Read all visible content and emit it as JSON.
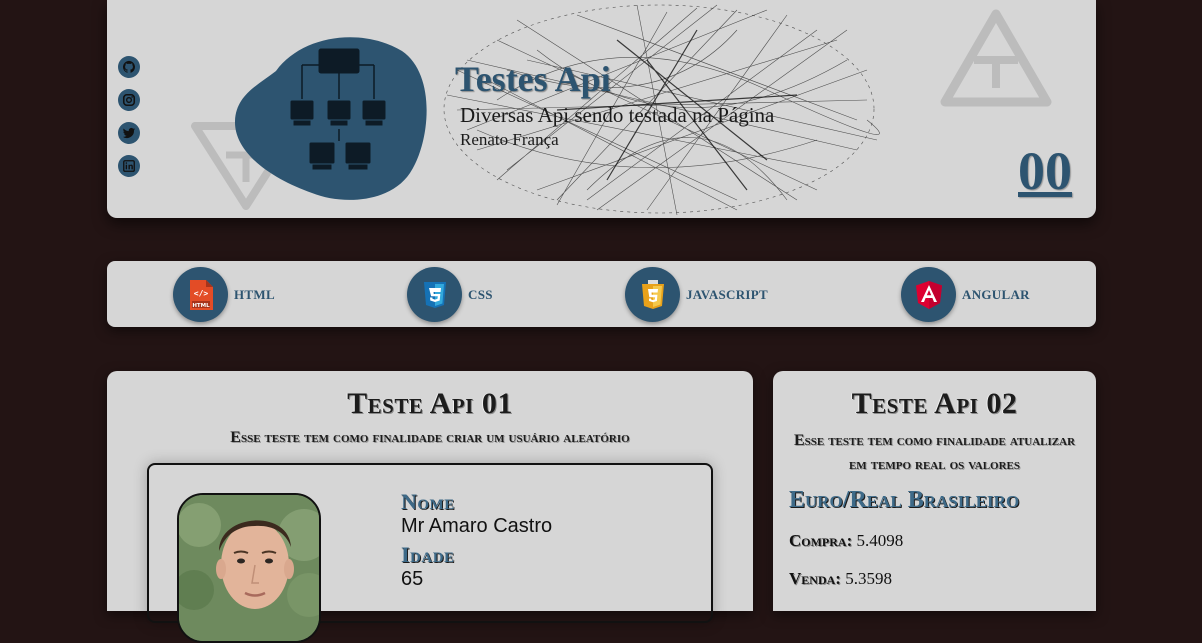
{
  "header": {
    "title": "Testes Api",
    "subtitle": "Diversas Api sendo testada na Página",
    "author": "Renato França",
    "counter": "00",
    "social": [
      "github-icon",
      "instagram-icon",
      "twitter-icon",
      "linkedin-icon"
    ]
  },
  "techs": [
    {
      "label": "HTML",
      "icon": "html5-file-icon",
      "color": "#e34c26"
    },
    {
      "label": "CSS",
      "icon": "css3-icon",
      "color": "#1572b6"
    },
    {
      "label": "JAVASCRIPT",
      "icon": "javascript-icon",
      "color": "#f0b429"
    },
    {
      "label": "ANGULAR",
      "icon": "angular-icon",
      "color": "#dd0031"
    }
  ],
  "card1": {
    "title": "Teste Api 01",
    "description": "Esse teste tem como finalidade criar um usuário aleatório",
    "name_label": "Nome",
    "name_value": "Mr Amaro Castro",
    "age_label": "Idade",
    "age_value": "65"
  },
  "card2": {
    "title": "Teste Api 02",
    "description": "Esse teste tem como finalidade atualizar em tempo real os valores",
    "pair_title": "Euro/Real Brasileiro",
    "buy_label": "Compra:",
    "buy_value": "5.4098",
    "sell_label": "Venda:",
    "sell_value": "5.3598"
  },
  "colors": {
    "background": "#231414",
    "panel": "#d6d6d6",
    "accent": "#2d5470"
  }
}
